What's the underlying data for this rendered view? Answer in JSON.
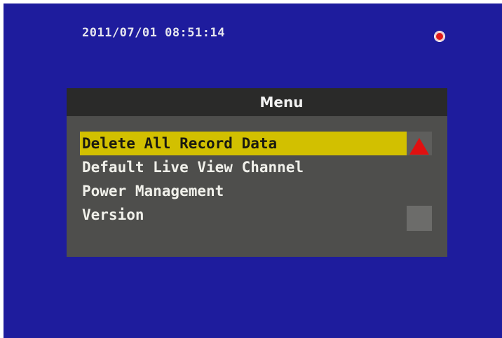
{
  "status": {
    "datetime": "2011/07/01 08:51:14",
    "record_indicator_icon": "record-dot-icon",
    "record_indicator_color": "#e21818"
  },
  "menu": {
    "title": "Menu",
    "items": [
      {
        "label": "Delete All Record Data",
        "selected": true
      },
      {
        "label": "Default Live View Channel",
        "selected": false
      },
      {
        "label": "Power Management",
        "selected": false
      },
      {
        "label": "Version",
        "selected": false
      }
    ],
    "scroll_up_icon": "triangle-up-icon",
    "scroll_down_icon": "scroll-square-icon"
  },
  "colors": {
    "screen_background": "#1e1c9d",
    "menu_background": "#4e4e4c",
    "menu_header": "#2a2a29",
    "selection_highlight": "#d2c000"
  }
}
